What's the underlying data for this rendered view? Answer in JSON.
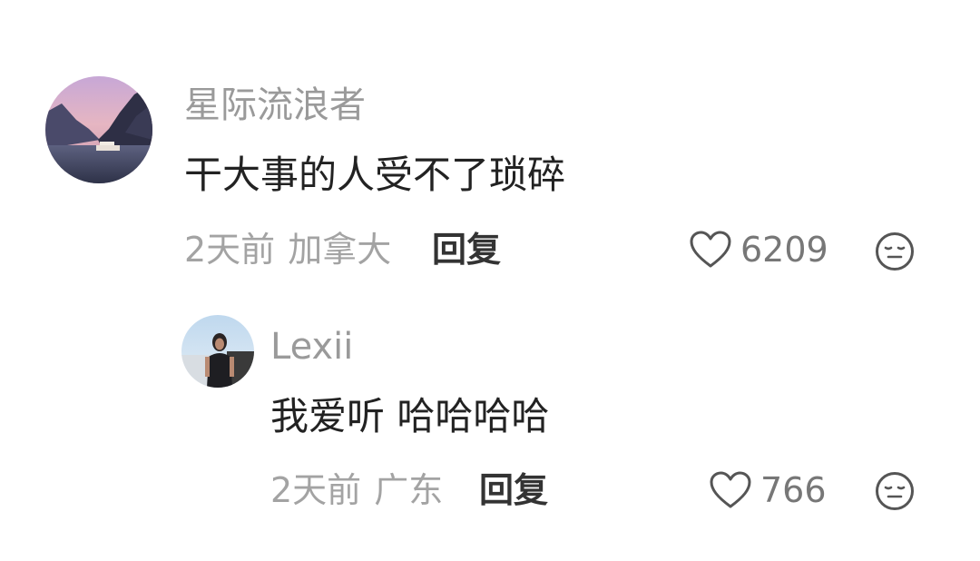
{
  "comments": [
    {
      "avatar_icon": "landscape-avatar",
      "username": "星际流浪者",
      "text": "干大事的人受不了琐碎",
      "time": "2天前",
      "location": "加拿大",
      "reply_label": "回复",
      "likes": "6209",
      "reaction_icon": "neutral-face-icon"
    },
    {
      "avatar_icon": "person-avatar",
      "username": "Lexii",
      "text": "我爱听 哈哈哈哈",
      "time": "2天前",
      "location": "广东",
      "reply_label": "回复",
      "likes": "766",
      "reaction_icon": "neutral-face-icon"
    }
  ],
  "colors": {
    "username": "#9a9a9a",
    "text": "#222222",
    "meta": "#a3a3a3",
    "reply": "#333333",
    "icon": "#555555"
  }
}
